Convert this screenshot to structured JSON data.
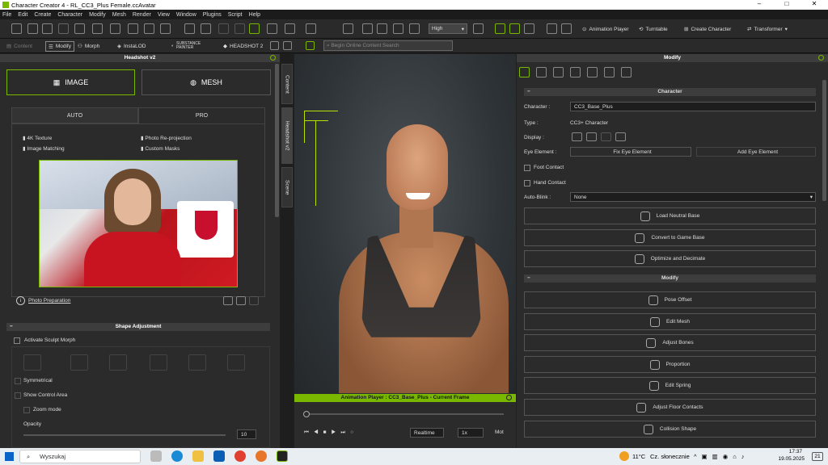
{
  "window": {
    "title": "Character Creator 4 - RL_CC3_Plus Female.ccAvatar",
    "min": "–",
    "max": "□",
    "close": "✕"
  },
  "menu": [
    "File",
    "Edit",
    "Create",
    "Character",
    "Modify",
    "Mesh",
    "Render",
    "View",
    "Window",
    "Plugins",
    "Script",
    "Help"
  ],
  "toolbar": {
    "quality": "High",
    "animation_player": "Animation Player",
    "turntable": "Turntable",
    "create_character": "Create Character",
    "transformer": "Transformer"
  },
  "toolbar2": {
    "content": "Content",
    "modify": "Modify",
    "morph": "Morph",
    "instalod": "InstaLOD",
    "substance": "SUBSTANCE PAINTER",
    "headshot2": "HEADSHOT 2",
    "search_placeholder": "Begin Online Content Search"
  },
  "left_panel": {
    "title": "Headshot v2",
    "image_button": "IMAGE",
    "mesh_button": "MESH",
    "tabs": [
      "AUTO",
      "PRO"
    ],
    "features": [
      "4K Texture",
      "Photo Re-projection",
      "Image Matching",
      "Custom Masks"
    ],
    "photo_prep": "Photo Preparation",
    "shape_adjustment": "Shape Adjustment",
    "activate_sculpt": "Activate Sculpt Morph",
    "symmetrical": "Symmetrical",
    "show_control": "Show Control Area",
    "zoom_mode": "Zoom mode",
    "opacity": "Opacity",
    "opacity_value": "10"
  },
  "side_tabs": [
    "Content",
    "Headshot v2",
    "Scene"
  ],
  "anim_player": {
    "title": "Animation Player : CC3_Base_Plus - Current Frame",
    "realtime": "Realtime",
    "speed": "1x",
    "mot": "Mot"
  },
  "right_panel": {
    "title": "Modify",
    "character_section": "Character",
    "character_label": "Character :",
    "character_value": "CC3_Base_Plus",
    "type_label": "Type :",
    "type_value": "CC3+ Character",
    "display_label": "Display :",
    "eye_label": "Eye Element :",
    "fix_eye": "Fix Eye Element",
    "add_eye": "Add Eye Element",
    "foot_contact": "Foot Contact",
    "hand_contact": "Hand Contact",
    "autoblink_label": "Auto-Blink :",
    "autoblink_value": "None",
    "char_buttons": [
      "Load Neutral Base",
      "Convert to Game Base",
      "Optimize and Decimate"
    ],
    "modify_section": "Modify",
    "modify_buttons": [
      "Pose Offset",
      "Edit Mesh",
      "Adjust Bones",
      "Proportion",
      "Edit Spring",
      "Adjust Floor Contacts",
      "Collision Shape"
    ]
  },
  "taskbar": {
    "search": "Wyszukaj",
    "weather_temp": "11°C",
    "weather_text": "Cz. słonecznie",
    "time": "17:37",
    "date": "19.05.2025",
    "badge": "21"
  }
}
